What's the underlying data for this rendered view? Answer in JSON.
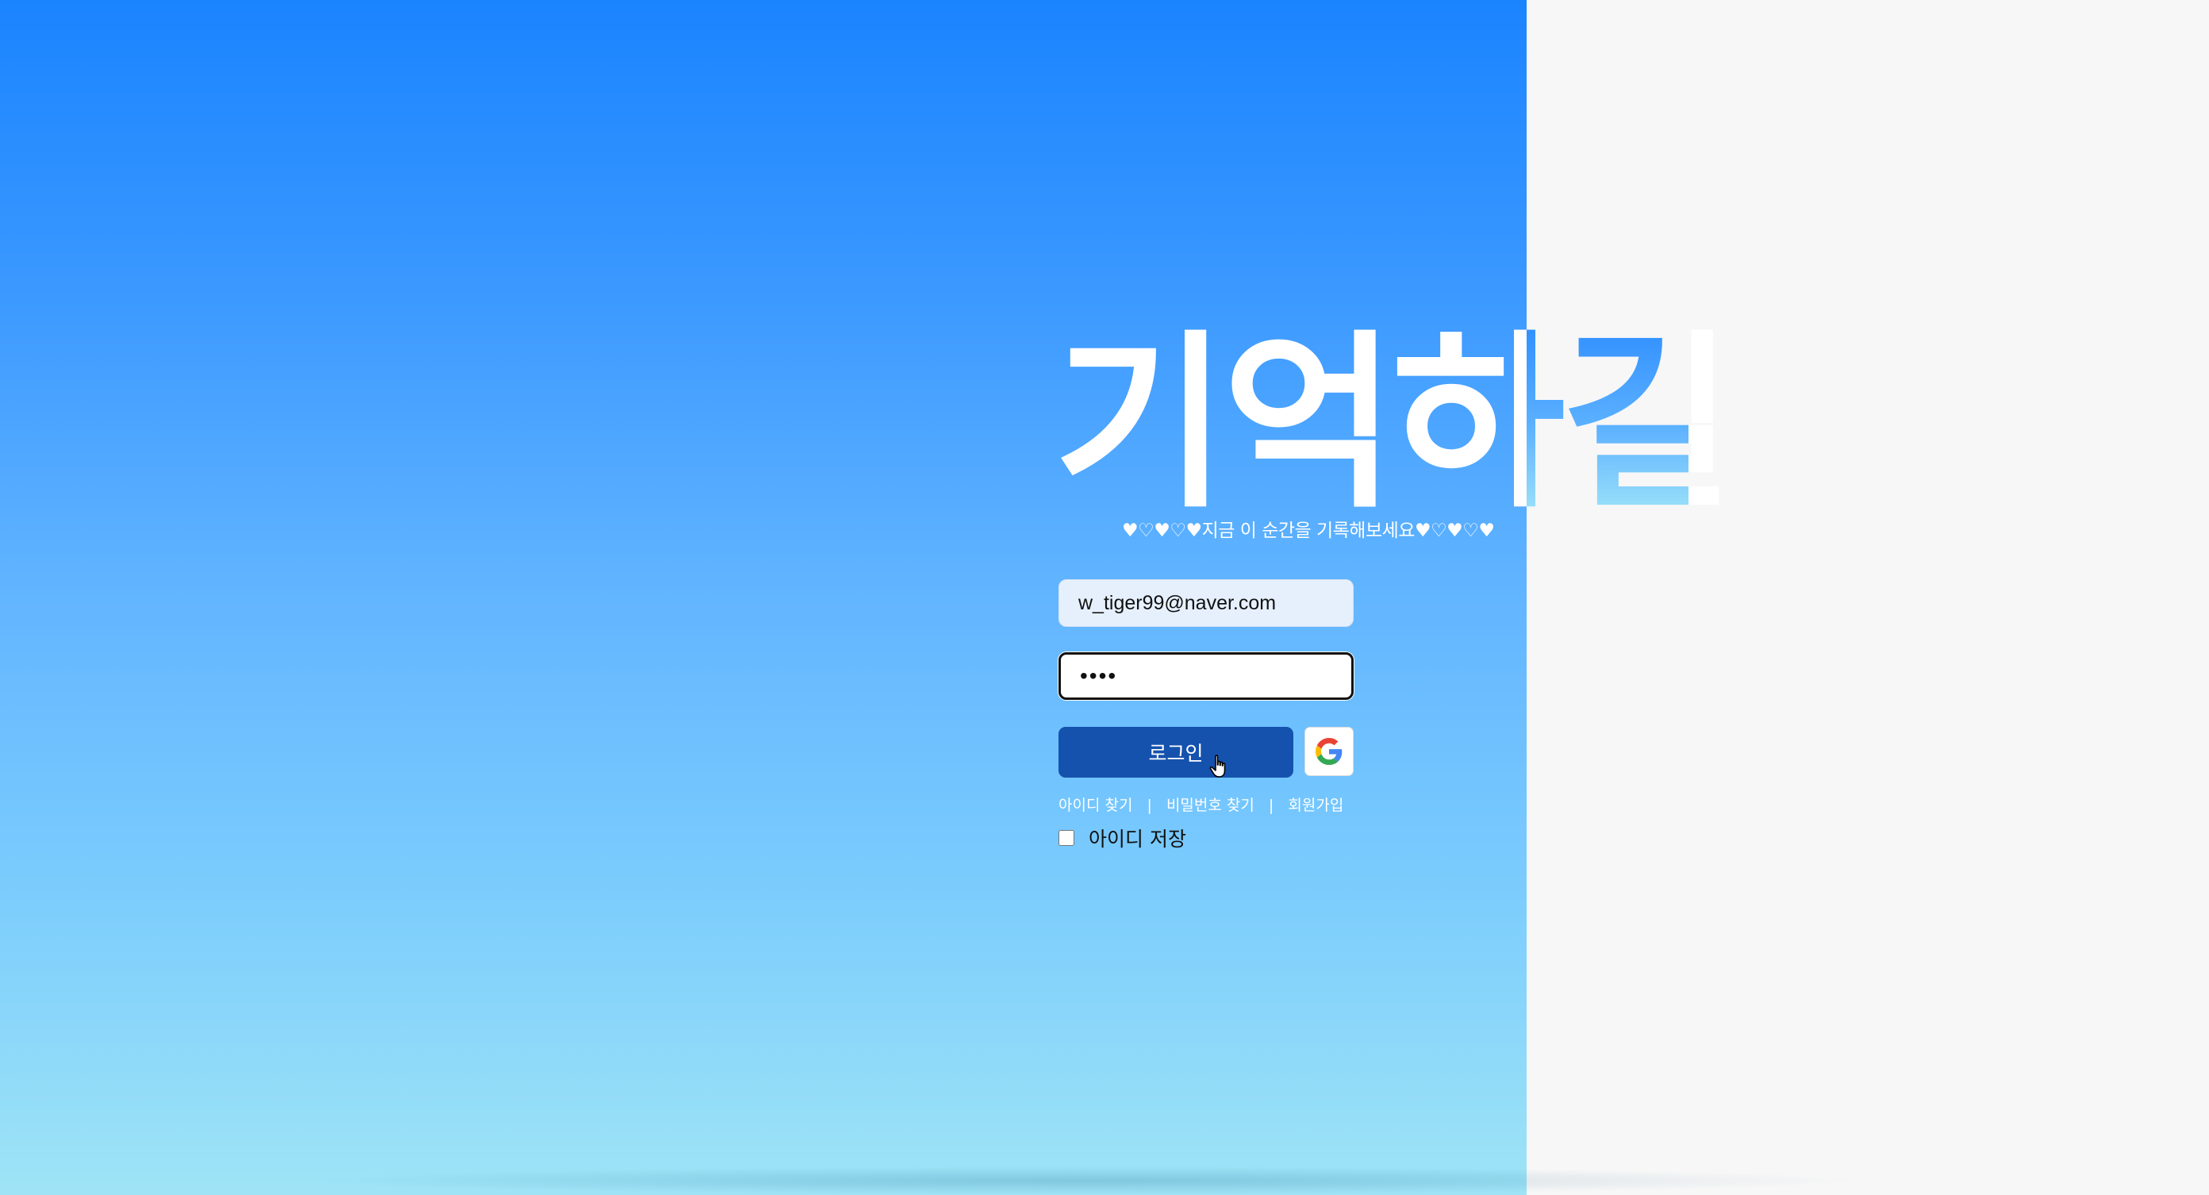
{
  "app": {
    "title": "기억하길",
    "tagline": "♥♡♥♡♥지금 이 순간을 기록해보세요♥♡♥♡♥"
  },
  "login_form": {
    "email_value": "w_tiger99@naver.com",
    "password_value": "1234",
    "login_label": "로그인",
    "google_icon": "google-icon"
  },
  "links": {
    "find_id": "아이디 찾기",
    "find_password": "비밀번호 찾기",
    "signup": "회원가입",
    "separator": "|"
  },
  "remember": {
    "label": "아이디 저장",
    "checked": false
  },
  "colors": {
    "primary_button": "#1552ad",
    "gradient_top": "#1a84ff",
    "gradient_bottom": "#9fe4f6",
    "right_panel": "#f7f7f7"
  }
}
